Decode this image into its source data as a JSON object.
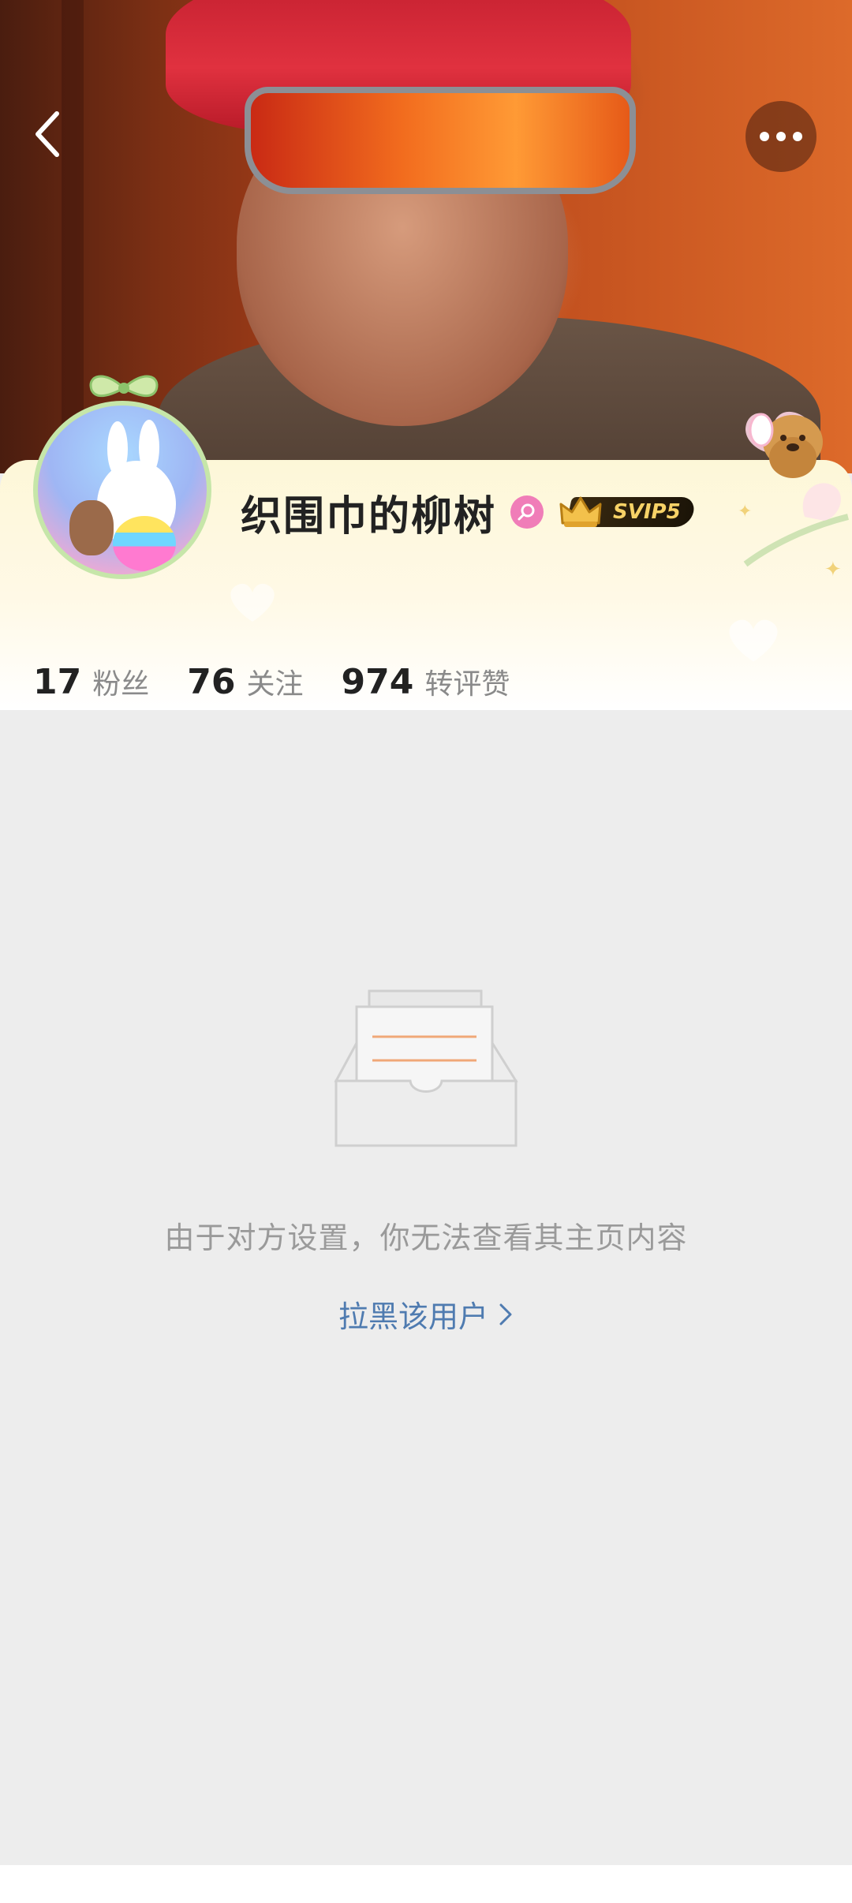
{
  "profile": {
    "name": "织围巾的柳树",
    "vip_level": "SVIP5",
    "gender": "female"
  },
  "stats": [
    {
      "count": "17",
      "label": "粉丝"
    },
    {
      "count": "76",
      "label": "关注"
    },
    {
      "count": "974",
      "label": "转评赞"
    }
  ],
  "empty_state": {
    "message": "由于对方设置，你无法查看其主页内容",
    "block_link": "拉黑该用户"
  },
  "colors": {
    "link": "#4f7bb0",
    "background": "#ededed",
    "card_top": "#fdf7d8",
    "gender_badge": "#f07db8",
    "svip_gold": "#f7d267"
  },
  "icons": {
    "back": "back-arrow-icon",
    "more": "more-dots-icon",
    "gender": "female-icon",
    "vip": "crown-icon",
    "link_arrow": "chevron-right-icon",
    "empty": "empty-tray-icon"
  }
}
